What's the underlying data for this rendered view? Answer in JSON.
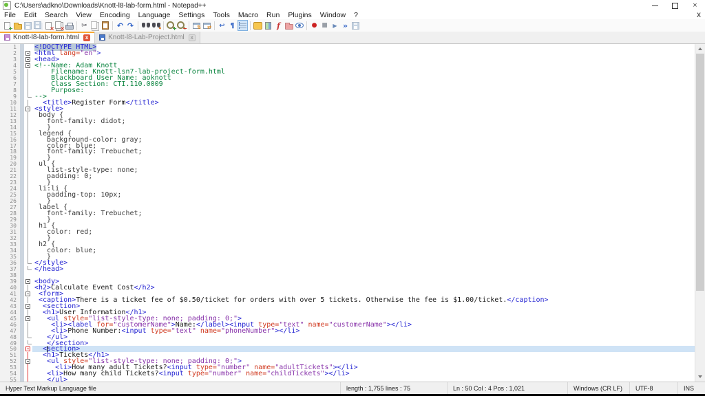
{
  "window": {
    "title": "C:\\Users\\adkno\\Downloads\\Knott-l8-lab-form.html - Notepad++"
  },
  "menu": {
    "items": [
      "File",
      "Edit",
      "Search",
      "View",
      "Encoding",
      "Language",
      "Settings",
      "Tools",
      "Macro",
      "Run",
      "Plugins",
      "Window",
      "?"
    ],
    "close_label": "X"
  },
  "toolbar": {
    "groups": [
      [
        "new-file",
        "open-file",
        "save-file",
        "save-all",
        "close-file",
        "close-all",
        "print"
      ],
      [
        "cut",
        "copy",
        "paste"
      ],
      [
        "undo",
        "redo"
      ],
      [
        "find",
        "replace"
      ],
      [
        "zoom-in",
        "zoom-out"
      ],
      [
        "sync-vertical-scroll",
        "sync-horizontal-scroll"
      ],
      [
        "word-wrap",
        "show-all-characters",
        "show-indent-guide"
      ],
      [
        "define-language",
        "document-map",
        "function-list",
        "folder-as-workspace",
        "monitoring"
      ],
      [
        "record-macro",
        "stop-recording",
        "playback-macro",
        "run-macro-multiple",
        "save-macro"
      ]
    ],
    "pressed": "show-indent-guide"
  },
  "tabs": [
    {
      "label": "Knott-l8-lab-form.html",
      "active": true,
      "disk_color": "#c98fd6",
      "disk_border": "#a06ab0",
      "close": "x"
    },
    {
      "label": "Knott-l8-Lab-Project.html",
      "active": false,
      "disk_color": "#4a78c8",
      "disk_border": "#35589a",
      "close": "x"
    }
  ],
  "editor": {
    "current_line": 50,
    "caret_col": 4,
    "lines": [
      {
        "n": 1,
        "f": "",
        "s": [
          [
            "t sel",
            "<!DOCTYPE HTML>"
          ]
        ]
      },
      {
        "n": 2,
        "f": "b",
        "s": [
          [
            "t",
            "<html "
          ],
          [
            "a",
            "lang="
          ],
          [
            "v",
            "\"en\""
          ],
          [
            "t",
            ">"
          ]
        ]
      },
      {
        "n": 3,
        "f": "b",
        "s": [
          [
            "t",
            "<head>"
          ]
        ]
      },
      {
        "n": 4,
        "f": "b",
        "s": [
          [
            "c",
            "<!--Name: Adam Knott"
          ]
        ]
      },
      {
        "n": 5,
        "f": "l",
        "s": [
          [
            "c",
            "    Filename: Knott-lsn7-lab-project-form.html"
          ]
        ]
      },
      {
        "n": 6,
        "f": "l",
        "s": [
          [
            "c",
            "    Blackboard User Name: aoknott"
          ]
        ]
      },
      {
        "n": 7,
        "f": "l",
        "s": [
          [
            "c",
            "    Class Section: CTI.110.0009"
          ]
        ]
      },
      {
        "n": 8,
        "f": "l",
        "s": [
          [
            "c",
            "    Purpose:"
          ]
        ]
      },
      {
        "n": 9,
        "f": "c",
        "s": [
          [
            "c",
            "-->"
          ]
        ]
      },
      {
        "n": 10,
        "f": "l",
        "s": [
          [
            "p",
            "  "
          ],
          [
            "t",
            "<title>"
          ],
          [
            "x",
            "Register Form"
          ],
          [
            "t",
            "</title>"
          ]
        ]
      },
      {
        "n": 11,
        "f": "b",
        "s": [
          [
            "t",
            "<style>"
          ]
        ]
      },
      {
        "n": 12,
        "f": "l",
        "s": [
          [
            "y",
            " body {"
          ]
        ]
      },
      {
        "n": 13,
        "f": "l",
        "s": [
          [
            "y",
            "   font-family: didot;"
          ]
        ]
      },
      {
        "n": 14,
        "f": "l",
        "s": [
          [
            "y",
            "   }"
          ]
        ]
      },
      {
        "n": 15,
        "f": "l",
        "s": [
          [
            "y",
            " legend {"
          ]
        ]
      },
      {
        "n": 16,
        "f": "l",
        "s": [
          [
            "y",
            "   background-color: gray;"
          ]
        ]
      },
      {
        "n": 17,
        "f": "l",
        "s": [
          [
            "y",
            "   color: blue;"
          ]
        ]
      },
      {
        "n": 18,
        "f": "l",
        "s": [
          [
            "y",
            "   font-family: Trebuchet;"
          ]
        ]
      },
      {
        "n": 19,
        "f": "l",
        "s": [
          [
            "y",
            "   }"
          ]
        ]
      },
      {
        "n": 20,
        "f": "l",
        "s": [
          [
            "y",
            " ul {"
          ]
        ]
      },
      {
        "n": 21,
        "f": "l",
        "s": [
          [
            "y",
            "   list-style-type: none;"
          ]
        ]
      },
      {
        "n": 22,
        "f": "l",
        "s": [
          [
            "y",
            "   padding: 0;"
          ]
        ]
      },
      {
        "n": 23,
        "f": "l",
        "s": [
          [
            "y",
            "   }"
          ]
        ]
      },
      {
        "n": 24,
        "f": "l",
        "s": [
          [
            "y",
            " li:li {"
          ]
        ]
      },
      {
        "n": 25,
        "f": "l",
        "s": [
          [
            "y",
            "   padding-top: 10px;"
          ]
        ]
      },
      {
        "n": 26,
        "f": "l",
        "s": [
          [
            "y",
            "   }"
          ]
        ]
      },
      {
        "n": 27,
        "f": "l",
        "s": [
          [
            "y",
            " label {"
          ]
        ]
      },
      {
        "n": 28,
        "f": "l",
        "s": [
          [
            "y",
            "   font-family: Trebuchet;"
          ]
        ]
      },
      {
        "n": 29,
        "f": "l",
        "s": [
          [
            "y",
            "   }"
          ]
        ]
      },
      {
        "n": 30,
        "f": "l",
        "s": [
          [
            "y",
            " h1 {"
          ]
        ]
      },
      {
        "n": 31,
        "f": "l",
        "s": [
          [
            "y",
            "   color: red;"
          ]
        ]
      },
      {
        "n": 32,
        "f": "l",
        "s": [
          [
            "y",
            "   }"
          ]
        ]
      },
      {
        "n": 33,
        "f": "l",
        "s": [
          [
            "y",
            " h2 {"
          ]
        ]
      },
      {
        "n": 34,
        "f": "l",
        "s": [
          [
            "y",
            "   color: blue;"
          ]
        ]
      },
      {
        "n": 35,
        "f": "l",
        "s": [
          [
            "y",
            "   }"
          ]
        ]
      },
      {
        "n": 36,
        "f": "c",
        "s": [
          [
            "t",
            "</style>"
          ]
        ]
      },
      {
        "n": 37,
        "f": "c",
        "s": [
          [
            "t",
            "</head>"
          ]
        ]
      },
      {
        "n": 38,
        "f": "",
        "s": []
      },
      {
        "n": 39,
        "f": "b",
        "s": [
          [
            "t",
            "<body>"
          ]
        ]
      },
      {
        "n": 40,
        "f": "l",
        "s": [
          [
            "t",
            "<h2>"
          ],
          [
            "x",
            "Calculate Event Cost"
          ],
          [
            "t",
            "</h2>"
          ]
        ]
      },
      {
        "n": 41,
        "f": "b",
        "s": [
          [
            "p",
            " "
          ],
          [
            "t",
            "<form>"
          ]
        ]
      },
      {
        "n": 42,
        "f": "l",
        "s": [
          [
            "p",
            " "
          ],
          [
            "t",
            "<caption>"
          ],
          [
            "x",
            "There is a ticket fee of $0.50/ticket for orders with over 5 tickets. Otherwise the fee is $1.00/ticket."
          ],
          [
            "t",
            "</caption>"
          ]
        ]
      },
      {
        "n": 43,
        "f": "b",
        "s": [
          [
            "p",
            "  "
          ],
          [
            "t",
            "<section>"
          ]
        ]
      },
      {
        "n": 44,
        "f": "l",
        "s": [
          [
            "p",
            "  "
          ],
          [
            "t",
            "<h1>"
          ],
          [
            "x",
            "User Information"
          ],
          [
            "t",
            "</h1>"
          ]
        ]
      },
      {
        "n": 45,
        "f": "b",
        "s": [
          [
            "p",
            "   "
          ],
          [
            "t",
            "<ul "
          ],
          [
            "a",
            "style="
          ],
          [
            "v",
            "\"list-style-type: none; padding: 0;\""
          ],
          [
            "t",
            ">"
          ]
        ]
      },
      {
        "n": 46,
        "f": "l",
        "s": [
          [
            "p",
            "    "
          ],
          [
            "t",
            "<li><label "
          ],
          [
            "a",
            "for="
          ],
          [
            "v",
            "\"customerName\""
          ],
          [
            "t",
            ">"
          ],
          [
            "x",
            "Name:"
          ],
          [
            "t",
            "</label><input "
          ],
          [
            "a",
            "type="
          ],
          [
            "v",
            "\"text\""
          ],
          [
            "p",
            " "
          ],
          [
            "a",
            "name="
          ],
          [
            "v",
            "\"customerName\""
          ],
          [
            "t",
            "></li>"
          ]
        ]
      },
      {
        "n": 47,
        "f": "l",
        "s": [
          [
            "p",
            "    "
          ],
          [
            "t",
            "<li>"
          ],
          [
            "x",
            "Phone Number:"
          ],
          [
            "t",
            "<input "
          ],
          [
            "a",
            "type="
          ],
          [
            "v",
            "\"text\""
          ],
          [
            "p",
            " "
          ],
          [
            "a",
            "name="
          ],
          [
            "v",
            "\"phoneNumber\""
          ],
          [
            "t",
            "></li>"
          ]
        ]
      },
      {
        "n": 48,
        "f": "c",
        "s": [
          [
            "p",
            "   "
          ],
          [
            "t",
            "</ul>"
          ]
        ]
      },
      {
        "n": 49,
        "f": "c",
        "s": [
          [
            "p",
            "   "
          ],
          [
            "t",
            "</section>"
          ]
        ]
      },
      {
        "n": 50,
        "f": "B",
        "s": [
          [
            "p",
            "  "
          ],
          [
            "t",
            "<section>"
          ]
        ]
      },
      {
        "n": 51,
        "f": "L",
        "s": [
          [
            "p",
            "  "
          ],
          [
            "t",
            "<h1>"
          ],
          [
            "x",
            "Tickets"
          ],
          [
            "t",
            "</h1>"
          ]
        ]
      },
      {
        "n": 52,
        "f": "bL",
        "s": [
          [
            "p",
            "   "
          ],
          [
            "t",
            "<ul "
          ],
          [
            "a",
            "style="
          ],
          [
            "v",
            "\"list-style-type: none; padding: 0;\""
          ],
          [
            "t",
            ">"
          ]
        ]
      },
      {
        "n": 53,
        "f": "L",
        "s": [
          [
            "p",
            "     "
          ],
          [
            "t",
            "<li>"
          ],
          [
            "x",
            "How many adult Tickets?"
          ],
          [
            "t",
            "<input "
          ],
          [
            "a",
            "type="
          ],
          [
            "v",
            "\"number\""
          ],
          [
            "p",
            " "
          ],
          [
            "a",
            "name="
          ],
          [
            "v",
            "\"adultTickets\""
          ],
          [
            "t",
            "></li>"
          ]
        ]
      },
      {
        "n": 54,
        "f": "L",
        "s": [
          [
            "p",
            "   "
          ],
          [
            "t",
            "<li>"
          ],
          [
            "x",
            "How many child Tickets?"
          ],
          [
            "t",
            "<input "
          ],
          [
            "a",
            "type="
          ],
          [
            "v",
            "\"number\""
          ],
          [
            "p",
            " "
          ],
          [
            "a",
            "name="
          ],
          [
            "v",
            "\"childTickets\""
          ],
          [
            "t",
            "></li>"
          ]
        ]
      },
      {
        "n": 55,
        "f": "L",
        "s": [
          [
            "p",
            "   "
          ],
          [
            "t",
            "</ul>"
          ]
        ]
      }
    ]
  },
  "status": {
    "doc_type": "Hyper Text Markup Language file",
    "length_lines": "length : 1,755    lines : 75",
    "position": "Ln : 50    Col : 4    Pos : 1,021",
    "eol": "Windows (CR LF)",
    "encoding": "UTF-8",
    "mode": "INS"
  }
}
